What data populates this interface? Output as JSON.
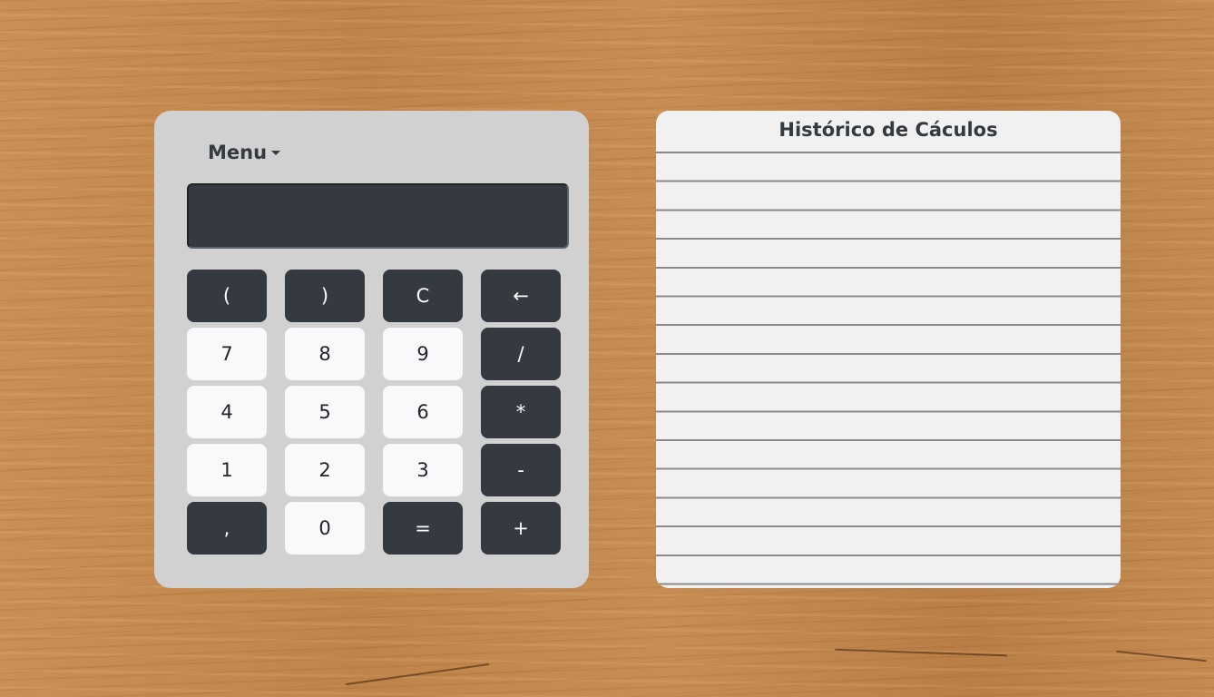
{
  "calculator": {
    "menu_label": "Menu",
    "display_value": "",
    "keys": [
      {
        "label": "(",
        "name": "key-open-paren",
        "style": "dark"
      },
      {
        "label": ")",
        "name": "key-close-paren",
        "style": "dark"
      },
      {
        "label": "C",
        "name": "key-clear",
        "style": "dark"
      },
      {
        "label": "←",
        "name": "key-backspace",
        "style": "dark"
      },
      {
        "label": "7",
        "name": "key-7",
        "style": "light"
      },
      {
        "label": "8",
        "name": "key-8",
        "style": "light"
      },
      {
        "label": "9",
        "name": "key-9",
        "style": "light"
      },
      {
        "label": "/",
        "name": "key-divide",
        "style": "dark"
      },
      {
        "label": "4",
        "name": "key-4",
        "style": "light"
      },
      {
        "label": "5",
        "name": "key-5",
        "style": "light"
      },
      {
        "label": "6",
        "name": "key-6",
        "style": "light"
      },
      {
        "label": "*",
        "name": "key-multiply",
        "style": "dark"
      },
      {
        "label": "1",
        "name": "key-1",
        "style": "light"
      },
      {
        "label": "2",
        "name": "key-2",
        "style": "light"
      },
      {
        "label": "3",
        "name": "key-3",
        "style": "light"
      },
      {
        "label": "-",
        "name": "key-subtract",
        "style": "dark"
      },
      {
        "label": ",",
        "name": "key-decimal",
        "style": "dark"
      },
      {
        "label": "0",
        "name": "key-0",
        "style": "light"
      },
      {
        "label": "=",
        "name": "key-equals",
        "style": "dark"
      },
      {
        "label": "+",
        "name": "key-add",
        "style": "dark"
      }
    ]
  },
  "history": {
    "title": "Histórico de Cáculos",
    "entries": []
  },
  "colors": {
    "dark_key": "#343a40",
    "light_key": "#f8f9fa",
    "calculator_body": "#d1d1d1",
    "history_paper": "#f1f1f1"
  }
}
